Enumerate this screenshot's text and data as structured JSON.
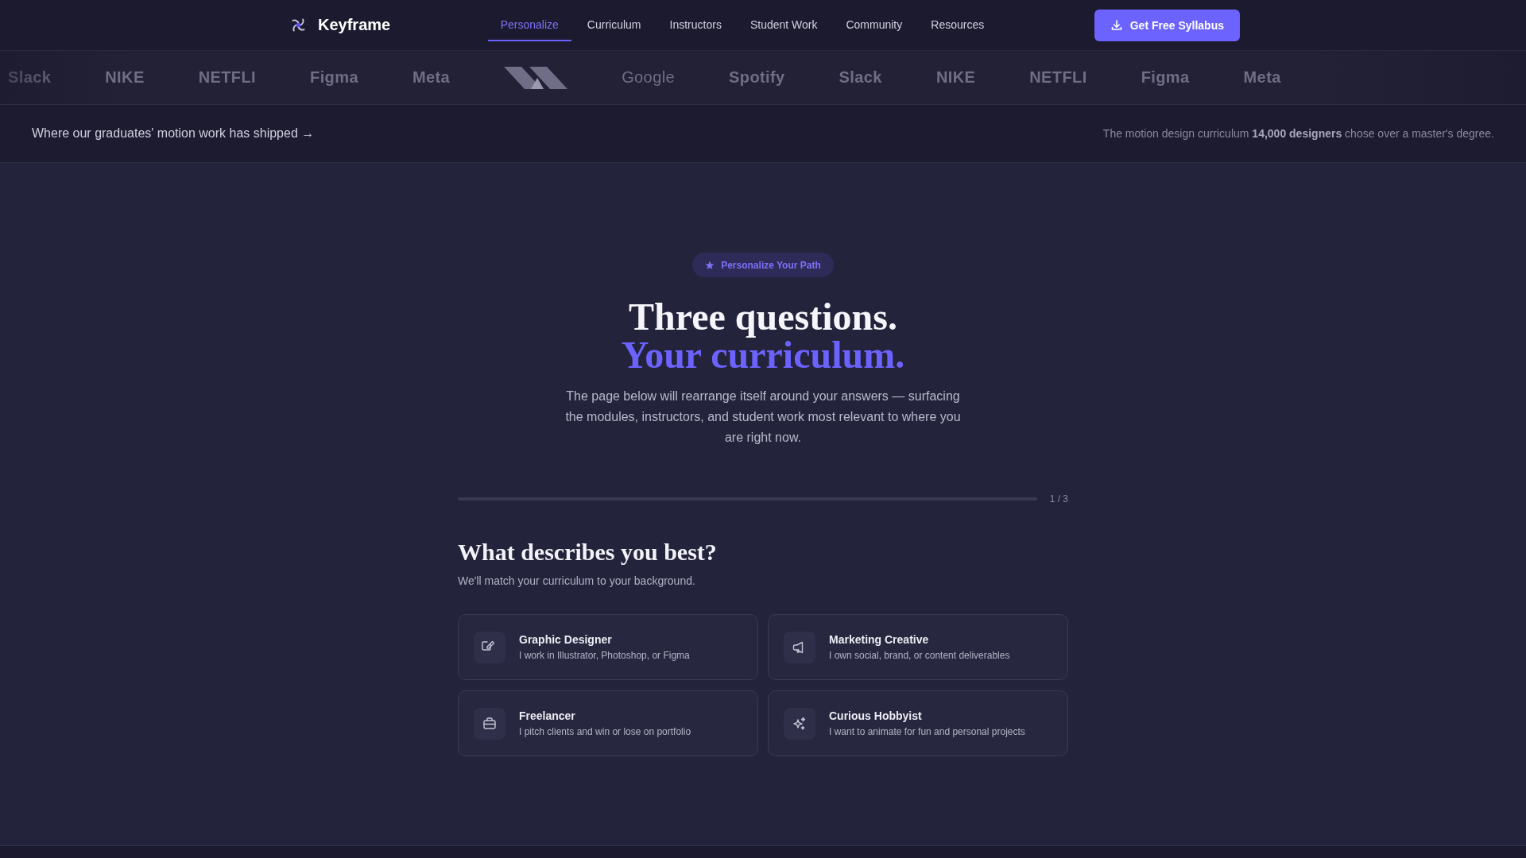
{
  "nav": {
    "brand": "Keyframe",
    "tabs": [
      {
        "label": "Personalize",
        "selected": true
      },
      {
        "label": "Curriculum",
        "selected": false
      },
      {
        "label": "Instructors",
        "selected": false
      },
      {
        "label": "Student Work",
        "selected": false
      },
      {
        "label": "Community",
        "selected": false
      },
      {
        "label": "Resources",
        "selected": false
      }
    ],
    "cta": "Get Free Syllabus"
  },
  "logo_strip": {
    "logos": [
      {
        "kind": "bold",
        "name": "Slack"
      },
      {
        "kind": "bold",
        "name": "NIKE"
      },
      {
        "kind": "bold",
        "name": "NETFLI"
      },
      {
        "kind": "bold",
        "name": "Figma"
      },
      {
        "kind": "bold",
        "name": "Meta"
      },
      {
        "kind": "mark"
      },
      {
        "kind": "regular",
        "name": "Google"
      },
      {
        "kind": "bold",
        "name": "Spotify"
      },
      {
        "kind": "bold",
        "name": "Slack"
      },
      {
        "kind": "bold",
        "name": "NIKE"
      },
      {
        "kind": "bold",
        "name": "NETFLI"
      },
      {
        "kind": "bold",
        "name": "Figma"
      },
      {
        "kind": "bold",
        "name": "Meta"
      }
    ]
  },
  "tagline_bar": {
    "link": "Where our graduates' motion work has shipped →",
    "note": "The motion design curriculum **14,000 designers** chose over a master's degree."
  },
  "hero": {
    "badge": "Personalize Your Path",
    "title": "Three questions.",
    "title_accent": "Your curriculum.",
    "intro": "The page below will rearrange itself around your answers — surfacing the modules, instructors, and student work most relevant to where you are right now."
  },
  "quiz": {
    "progress": {
      "reading": "1 / 3"
    },
    "question": "What describes you best?",
    "hint": "We'll match your curriculum to your background.",
    "options": [
      {
        "title": "Graphic Designer",
        "description": "I work in Illustrator, Photoshop, or Figma",
        "selected": false
      },
      {
        "title": "Marketing Creative",
        "description": "I own social, brand, or content deliverables",
        "selected": false
      },
      {
        "title": "Freelancer",
        "description": "I pitch clients and win or lose on portfolio",
        "selected": false
      },
      {
        "title": "Curious Hobbyist",
        "description": "I want to animate for fun and personal projects",
        "selected": false
      }
    ]
  }
}
